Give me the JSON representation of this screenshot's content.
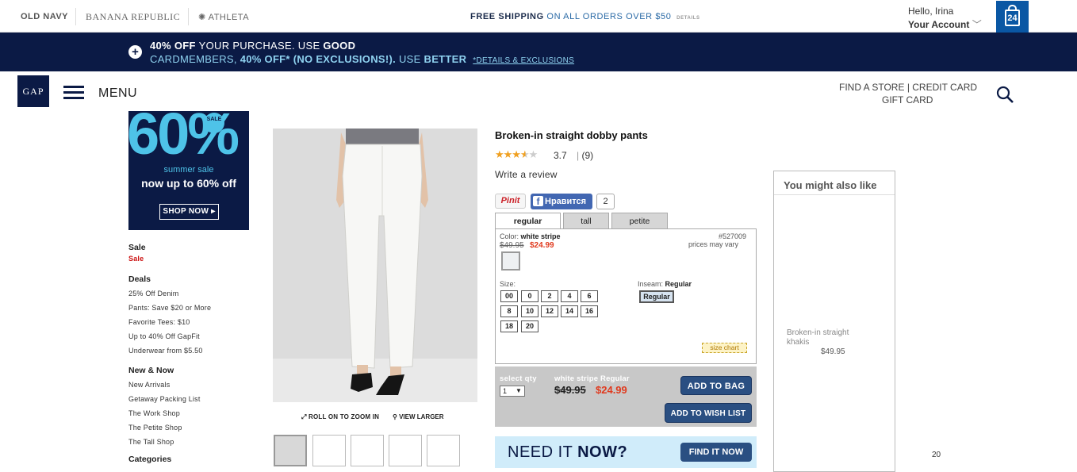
{
  "topbar": {
    "brands": [
      "OLD NAVY",
      "BANANA REPUBLIC",
      "ATHLETA"
    ],
    "shipping_bold": "FREE SHIPPING",
    "shipping_rest": "ON ALL ORDERS OVER $50",
    "shipping_details": "DETAILS",
    "hello": "Hello, Irina",
    "account": "Your Account",
    "bag_count": "24"
  },
  "promo": {
    "line1_bold": "40% OFF",
    "line1_a": "YOUR PURCHASE. USE",
    "line1_b": "GOOD",
    "line2_a": "CARDMEMBERS,",
    "line2_b": "40% OFF* (NO EXCLUSIONS!).",
    "line2_c": "USE",
    "line2_d": "BETTER",
    "line2_link": "*DETAILS & EXCLUSIONS"
  },
  "header": {
    "logo": "GAP",
    "menu": "MENU",
    "find_store": "FIND A STORE",
    "credit_card": "| CREDIT CARD",
    "gift_card": "GIFT CARD"
  },
  "sale_banner": {
    "percent": "60%",
    "badge": "SALE",
    "subtitle": "summer sale",
    "headline": "now up to 60% off",
    "cta": "SHOP NOW ▸"
  },
  "nav": {
    "sale_head": "Sale",
    "sale_link": "Sale",
    "deals_head": "Deals",
    "deals": [
      "25% Off Denim",
      "Pants: Save $20 or More",
      "Favorite Tees: $10",
      "Up to 40% Off GapFit",
      "Underwear from $5.50"
    ],
    "new_head": "New & Now",
    "new": [
      "New Arrivals",
      "Getaway Packing List",
      "The Work Shop",
      "The Petite Shop",
      "The Tall Shop"
    ],
    "cut_head": "Categories"
  },
  "image_tools": {
    "zoom": "ROLL ON TO ZOOM IN",
    "larger": "VIEW LARGER"
  },
  "product": {
    "title": "Broken-in straight dobby pants",
    "stars": "★★★★★",
    "rating": "3.7",
    "sep": "|",
    "reviews": "(9)",
    "write_review": "Write a review",
    "pin": "Pinit",
    "fb_like": "Нравится",
    "fb_count": "2",
    "tabs": [
      "regular",
      "tall",
      "petite"
    ],
    "color_label": "Color:",
    "color_value": "white stripe",
    "old_price": "$49.95",
    "new_price": "$24.99",
    "sku": "#527009",
    "prices_vary": "prices may vary",
    "size_label": "Size:",
    "sizes_row1": [
      "00",
      "0",
      "2",
      "4",
      "6"
    ],
    "sizes_row2": [
      "8",
      "10",
      "12",
      "14",
      "16"
    ],
    "sizes_row3": [
      "18",
      "20"
    ],
    "inseam_label": "Inseam:",
    "inseam_value": "Regular",
    "inseam_btn": "Regular",
    "size_chart": "size chart"
  },
  "addbar": {
    "select_qty": "select qty",
    "qty": "1",
    "item": "white stripe Regular",
    "old_price": "$49.95",
    "new_price": "$24.99",
    "add_bag": "ADD TO BAG",
    "add_wish": "ADD TO WISH LIST"
  },
  "need_it": {
    "a": "NEED IT",
    "b": "NOW?",
    "cta": "FIND IT NOW"
  },
  "recs": {
    "title": "You might also like",
    "name_line1": "Broken-in straight",
    "name_line2": "khakis",
    "price": "$49.95"
  },
  "misc": {
    "corner_num": "20"
  },
  "colors": {
    "navy": "#0b1a45",
    "sale_cyan": "#4ec3e8",
    "price_red": "#e03a1e",
    "button_blue": "#2a4f82"
  }
}
